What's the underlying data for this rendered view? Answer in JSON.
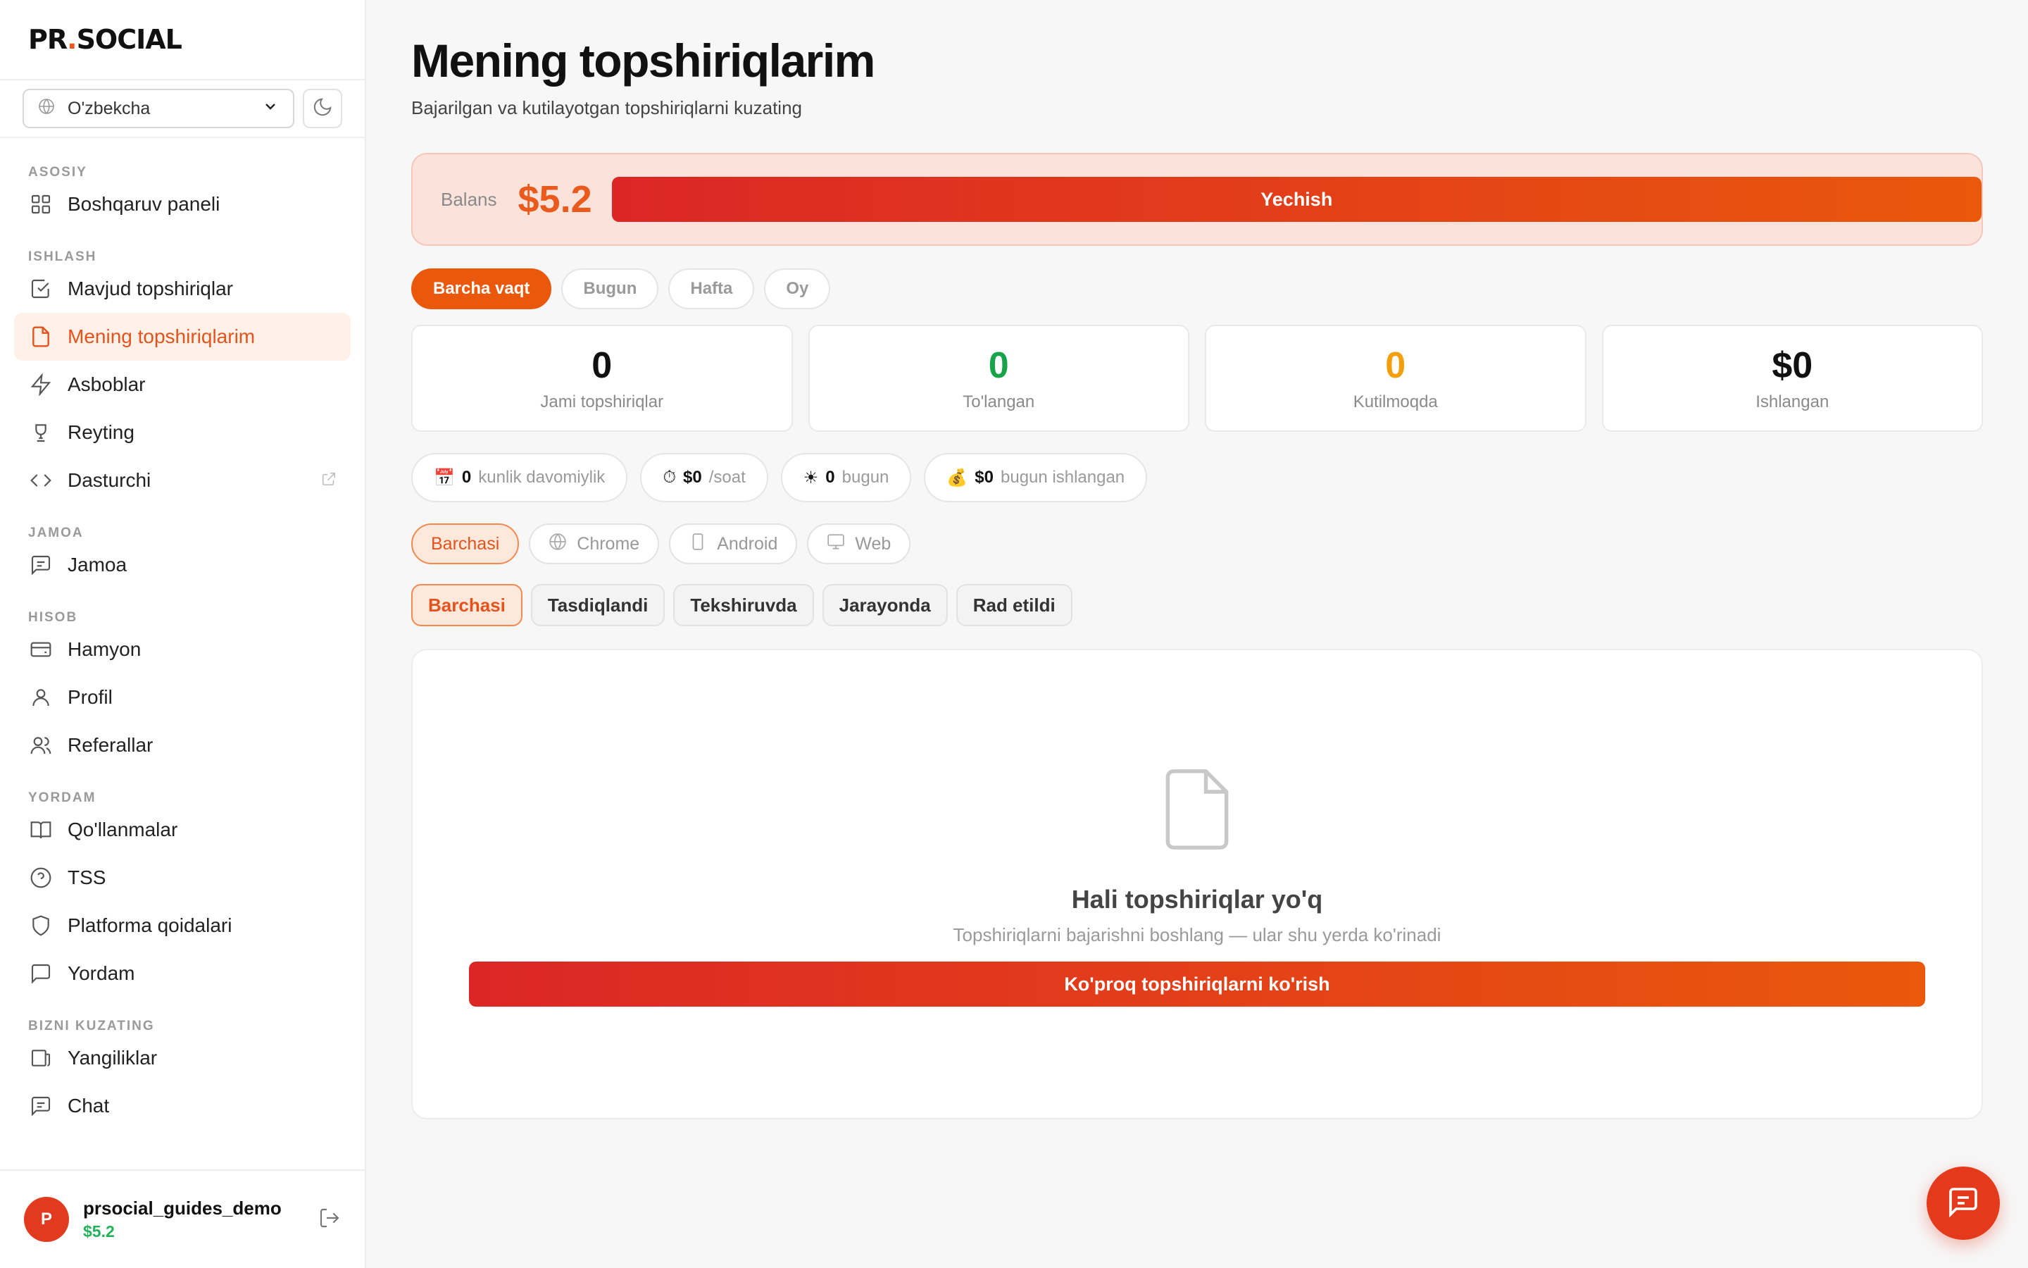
{
  "brand": {
    "name_part1": "PR",
    "dot": ".",
    "name_part2": "SOCIAL",
    "accent": "#f0541e"
  },
  "language": {
    "selected": "O'zbekcha"
  },
  "sidebar": {
    "sections": [
      {
        "title": "ASOSIY",
        "items": [
          {
            "label": "Boshqaruv paneli",
            "icon": "dashboard-icon"
          }
        ]
      },
      {
        "title": "ISHLASH",
        "items": [
          {
            "label": "Mavjud topshiriqlar",
            "icon": "checkbox-icon"
          },
          {
            "label": "Mening topshiriqlarim",
            "icon": "file-icon",
            "active": true
          },
          {
            "label": "Asboblar",
            "icon": "bolt-icon"
          },
          {
            "label": "Reyting",
            "icon": "trophy-icon"
          },
          {
            "label": "Dasturchi",
            "icon": "code-icon"
          }
        ]
      },
      {
        "title": "JAMOA",
        "items": [
          {
            "label": "Jamoa",
            "icon": "message-square-icon"
          }
        ]
      },
      {
        "title": "HISOB",
        "items": [
          {
            "label": "Hamyon",
            "icon": "wallet-icon"
          },
          {
            "label": "Profil",
            "icon": "user-icon"
          },
          {
            "label": "Referallar",
            "icon": "users-icon"
          }
        ]
      },
      {
        "title": "YORDAM",
        "items": [
          {
            "label": "Qo'llanmalar",
            "icon": "book-icon"
          },
          {
            "label": "TSS",
            "icon": "help-circle-icon"
          },
          {
            "label": "Platforma qoidalari",
            "icon": "shield-icon"
          },
          {
            "label": "Yordam",
            "icon": "chat-bubble-icon"
          }
        ]
      },
      {
        "title": "BIZNI KUZATING",
        "items": [
          {
            "label": "Yangiliklar",
            "icon": "news-icon"
          },
          {
            "label": "Chat",
            "icon": "chat-icon"
          }
        ]
      }
    ]
  },
  "user": {
    "initial": "P",
    "name": "prsocial_guides_demo",
    "balance": "$5.2"
  },
  "page": {
    "title": "Mening topshiriqlarim",
    "subtitle": "Bajarilgan va kutilayotgan topshiriqlarni kuzating"
  },
  "balance": {
    "label": "Balans",
    "value": "$5.2",
    "withdraw_label": "Yechish"
  },
  "time_filters": [
    "Barcha vaqt",
    "Bugun",
    "Hafta",
    "Oy"
  ],
  "stats": [
    {
      "value": "0",
      "label": "Jami topshiriqlar",
      "color": "#111111"
    },
    {
      "value": "0",
      "label": "To'langan",
      "color": "#16a34a"
    },
    {
      "value": "0",
      "label": "Kutilmoqda",
      "color": "#f59e0b"
    },
    {
      "value": "$0",
      "label": "Ishlangan",
      "color": "#111111"
    }
  ],
  "chips": [
    {
      "emoji": "📅",
      "value": "0",
      "label": "kunlik davomiylik"
    },
    {
      "emoji": "⏱",
      "value": "$0",
      "label": "/soat"
    },
    {
      "emoji": "☀",
      "value": "0",
      "label": "bugun"
    },
    {
      "emoji": "💰",
      "value": "$0",
      "label": "bugun ishlangan"
    }
  ],
  "platform_filters": [
    {
      "label": "Barchasi",
      "icon": "",
      "active": true
    },
    {
      "label": "Chrome",
      "icon": "globe-icon"
    },
    {
      "label": "Android",
      "icon": "phone-icon"
    },
    {
      "label": "Web",
      "icon": "monitor-icon"
    }
  ],
  "status_filters": [
    "Barchasi",
    "Tasdiqlandi",
    "Tekshiruvda",
    "Jarayonda",
    "Rad etildi"
  ],
  "empty": {
    "title": "Hali topshiriqlar yo'q",
    "subtitle": "Topshiriqlarni bajarishni boshlang — ular shu yerda ko'rinadi",
    "cta": "Ko'proq topshiriqlarni ko'rish"
  }
}
